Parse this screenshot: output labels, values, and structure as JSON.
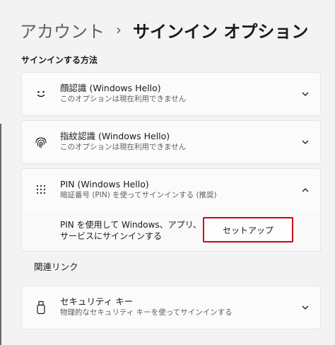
{
  "breadcrumb": {
    "parent": "アカウント",
    "separator": "›",
    "current": "サインイン オプション"
  },
  "section_title": "サインインする方法",
  "options": [
    {
      "id": "face",
      "title": "顔認識 (Windows Hello)",
      "subtitle": "このオプションは現在利用できません",
      "icon": "smile-face-icon",
      "expanded": false
    },
    {
      "id": "fingerprint",
      "title": "指紋認識 (Windows Hello)",
      "subtitle": "このオプションは現在利用できません",
      "icon": "fingerprint-icon",
      "expanded": false
    },
    {
      "id": "pin",
      "title": "PIN (Windows Hello)",
      "subtitle": "暗証番号 (PIN) を使ってサインインする (推奨)",
      "icon": "keypad-dots-icon",
      "expanded": true
    }
  ],
  "pin_panel": {
    "description_line1": "PIN を使用して Windows、アプリ、",
    "description_line2": "サービスにサインインする",
    "setup_label": "セットアップ",
    "highlight_color": "#d0021b"
  },
  "related_links_title": "関連リンク",
  "security_key": {
    "title": "セキュリティ キー",
    "subtitle": "物理的なセキュリティ キーを使ってサインインする",
    "icon": "usb-key-icon"
  }
}
